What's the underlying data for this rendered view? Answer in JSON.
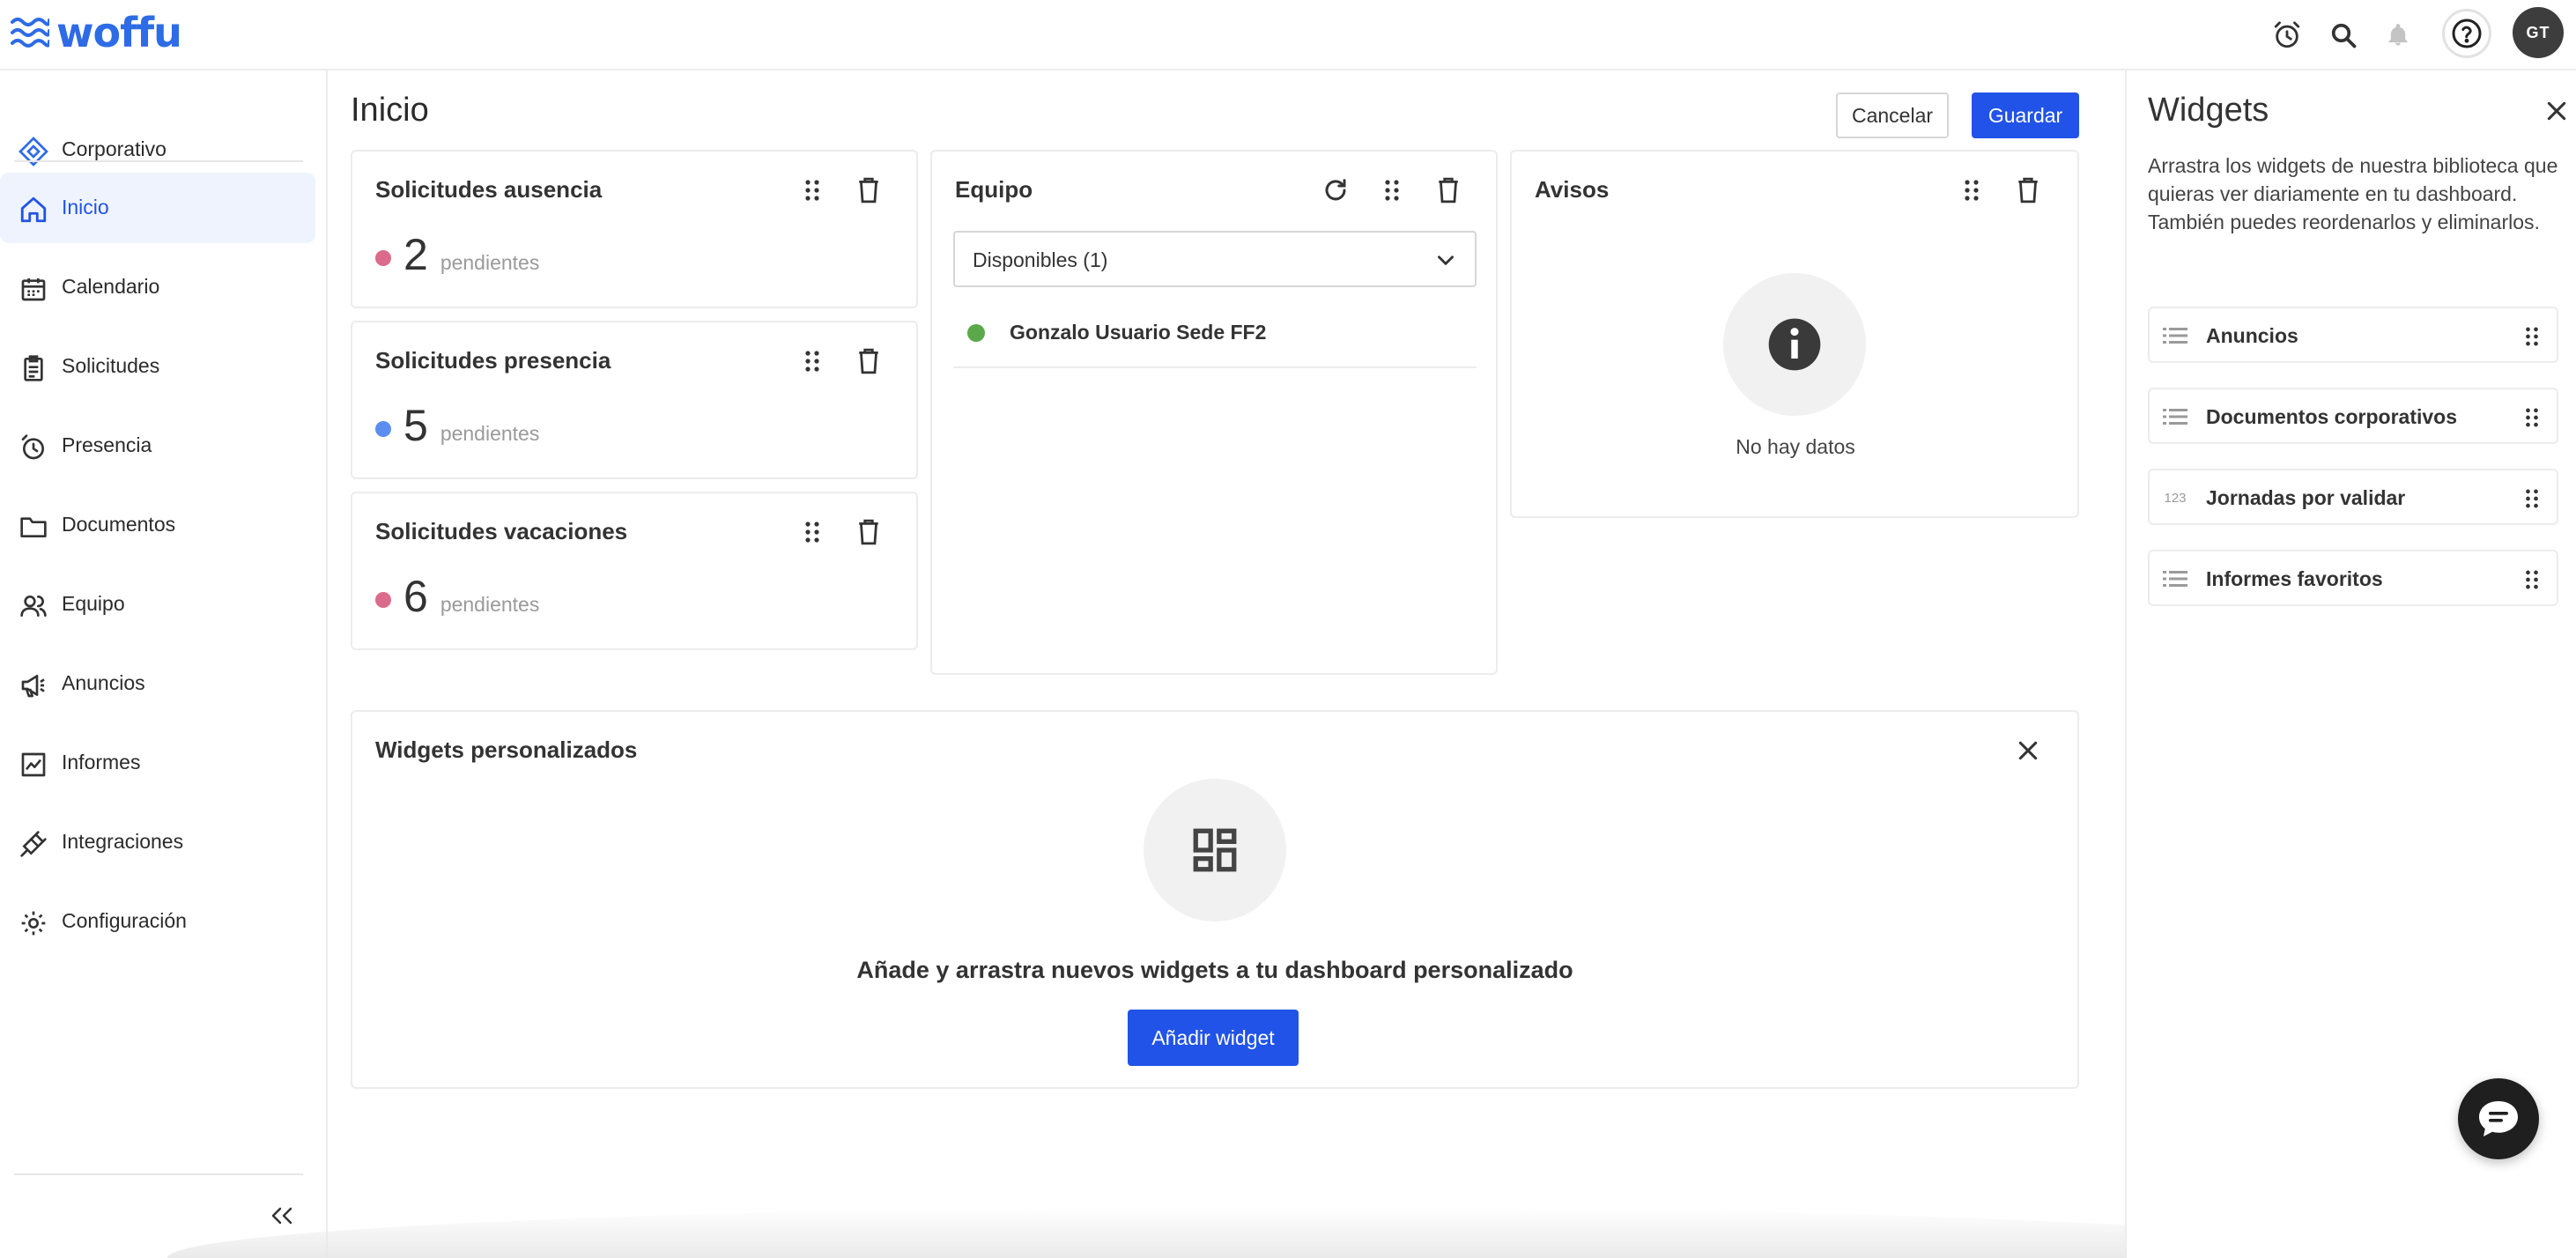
{
  "app": {
    "logo_text": "woffu",
    "brand_color": "#2e6be6",
    "accent_color": "#2153e8"
  },
  "topbar": {
    "icons": [
      "alarm-clock-icon",
      "search-icon",
      "bell-icon",
      "help-icon"
    ],
    "avatar_initials": "GT"
  },
  "sidebar": {
    "top_item": {
      "label": "Corporativo",
      "icon": "diamond-icon"
    },
    "items": [
      {
        "label": "Inicio",
        "icon": "home-icon",
        "active": true
      },
      {
        "label": "Calendario",
        "icon": "calendar-icon"
      },
      {
        "label": "Solicitudes",
        "icon": "clipboard-icon"
      },
      {
        "label": "Presencia",
        "icon": "clock-icon"
      },
      {
        "label": "Documentos",
        "icon": "folder-icon"
      },
      {
        "label": "Equipo",
        "icon": "team-icon"
      },
      {
        "label": "Anuncios",
        "icon": "megaphone-icon"
      },
      {
        "label": "Informes",
        "icon": "chart-icon"
      },
      {
        "label": "Integraciones",
        "icon": "plug-icon"
      },
      {
        "label": "Configuración",
        "icon": "gear-icon"
      }
    ],
    "collapse_label": "<<"
  },
  "main": {
    "title": "Inicio",
    "cancel_label": "Cancelar",
    "save_label": "Guardar",
    "request_cards": [
      {
        "title": "Solicitudes ausencia",
        "count": "2",
        "sub": "pendientes",
        "dot_color": "#dc6a8a"
      },
      {
        "title": "Solicitudes presencia",
        "count": "5",
        "sub": "pendientes",
        "dot_color": "#5b8ef0"
      },
      {
        "title": "Solicitudes vacaciones",
        "count": "6",
        "sub": "pendientes",
        "dot_color": "#dc6a8a"
      }
    ],
    "team_card": {
      "title": "Equipo",
      "select_value": "Disponibles (1)",
      "members": [
        {
          "name": "Gonzalo Usuario Sede FF2",
          "status_color": "#5aa84a"
        }
      ]
    },
    "notices_card": {
      "title": "Avisos",
      "empty_text": "No hay datos"
    },
    "custom_widgets": {
      "title": "Widgets personalizados",
      "message": "Añade y arrastra nuevos widgets a tu dashboard personalizado",
      "add_label": "Añadir widget"
    }
  },
  "panel": {
    "title": "Widgets",
    "description": "Arrastra los widgets de nuestra biblioteca que quieras ver diariamente en tu dashboard. También puedes reordenarlos y eliminarlos.",
    "widgets": [
      {
        "label": "Anuncios",
        "icon": "list-icon"
      },
      {
        "label": "Documentos corporativos",
        "icon": "list-icon"
      },
      {
        "label": "Jornadas por validar",
        "icon": "numeric-icon",
        "icon_text": "123"
      },
      {
        "label": "Informes favoritos",
        "icon": "list-icon"
      }
    ]
  }
}
